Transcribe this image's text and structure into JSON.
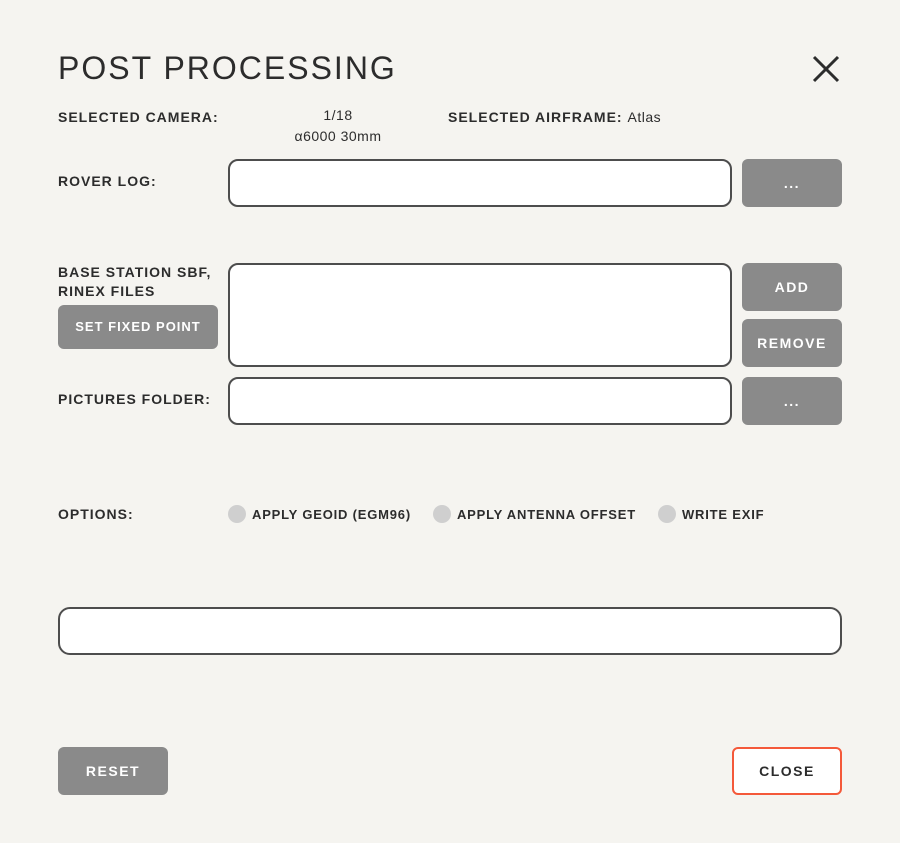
{
  "dialog": {
    "title": "POST PROCESSING"
  },
  "camera": {
    "label": "SELECTED CAMERA:",
    "index": "1/18",
    "name": "α6000 30mm"
  },
  "airframe": {
    "label": "SELECTED AIRFRAME:",
    "name": "Atlas"
  },
  "roverLog": {
    "label": "ROVER LOG:",
    "value": "",
    "browse": "..."
  },
  "baseStation": {
    "label": "BASE STATION SBF, RINEX FILES",
    "setFixedPoint": "SET FIXED POINT",
    "add": "ADD",
    "remove": "REMOVE"
  },
  "picturesFolder": {
    "label": "PICTURES FOLDER:",
    "value": "",
    "browse": "..."
  },
  "options": {
    "label": "OPTIONS:",
    "applyGeoid": "APPLY GEOID (EGM96)",
    "applyAntennaOffset": "APPLY ANTENNA OFFSET",
    "writeExif": "WRITE EXIF"
  },
  "footer": {
    "reset": "RESET",
    "close": "CLOSE"
  }
}
